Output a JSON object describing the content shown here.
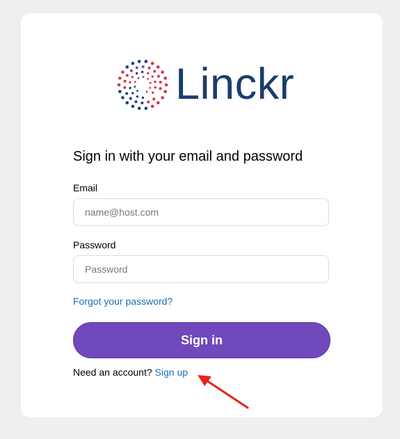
{
  "brand": {
    "name": "Linckr",
    "colors": {
      "wordmark": "#1a3d6e",
      "dot_red": "#d8344a",
      "dot_blue": "#1d3f77",
      "dot_purple": "#6e4fae"
    }
  },
  "form": {
    "heading": "Sign in with your email and password",
    "email": {
      "label": "Email",
      "placeholder": "name@host.com",
      "value": ""
    },
    "password": {
      "label": "Password",
      "placeholder": "Password",
      "value": ""
    },
    "forgot_link": "Forgot your password?",
    "submit_label": "Sign in",
    "signup_prompt": "Need an account?",
    "signup_link": "Sign up"
  },
  "colors": {
    "page_background": "#efefef",
    "card_background": "#ffffff",
    "button": "#7049bd",
    "link": "#1a6fb0",
    "annotation_arrow": "#e8211d"
  },
  "annotation": {
    "icon": "red-arrow-icon"
  }
}
